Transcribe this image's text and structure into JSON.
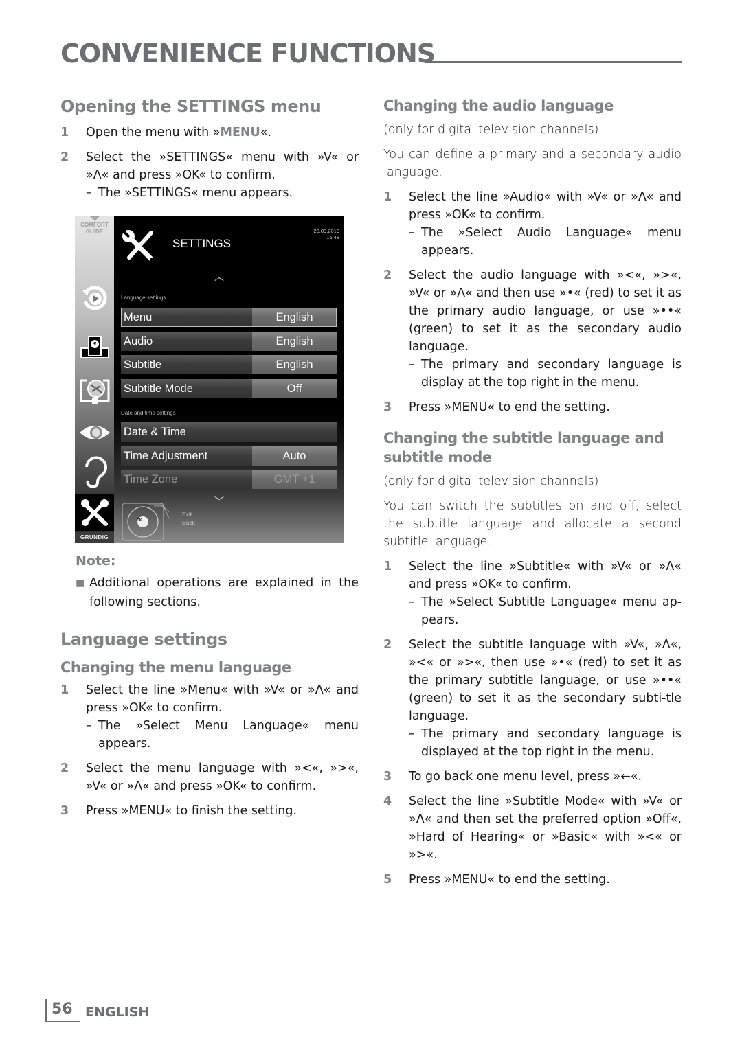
{
  "header": {
    "title": "CONVENIENCE FUNCTIONS"
  },
  "left": {
    "opening": {
      "heading": "Opening the SETTINGS menu",
      "steps": [
        {
          "num": "1",
          "parts": [
            "Open the menu with »",
            "MENU",
            "«."
          ]
        },
        {
          "num": "2",
          "text": "Select the »SETTINGS« menu with »V« or »Λ« and press »OK« to confirm.",
          "result": "The »SETTINGS« menu appears."
        }
      ]
    },
    "tv_screen": {
      "sidebar": {
        "comfort_guide": "COMFORT GUIDE",
        "brand": "GRUNDIG",
        "icons": [
          "playback-icon",
          "network-icon",
          "satellite-icon",
          "eye-icon",
          "ear-icon",
          "tools-icon"
        ]
      },
      "title": "SETTINGS",
      "date": "20.09.2010",
      "time": "15:48",
      "groups": [
        {
          "label": "Language settings",
          "rows": [
            {
              "label": "Menu",
              "value": "English",
              "selected": true
            },
            {
              "label": "Audio",
              "value": "English"
            },
            {
              "label": "Subtitle",
              "value": "English"
            },
            {
              "label": "Subtitle Mode",
              "value": "Off"
            }
          ]
        },
        {
          "label": "Date and time settings",
          "rows": [
            {
              "label": "Date & Time",
              "value": ""
            },
            {
              "label": "Time Adjustment",
              "value": "Auto"
            },
            {
              "label": "Time Zone",
              "value": "GMT +1",
              "disabled": true
            }
          ]
        }
      ],
      "remote": {
        "ok": "OK",
        "exit": "Exit",
        "back": "Back"
      }
    },
    "note": {
      "title": "Note:",
      "text": "Additional operations are explained in the following sections."
    },
    "language_settings": {
      "heading": "Language settings",
      "menu_language": {
        "heading": "Changing the menu language",
        "steps": [
          {
            "num": "1",
            "text": "Select the line »Menu« with »V« or »Λ« and press »OK« to confirm.",
            "result": "The »Select Menu Language« menu appears."
          },
          {
            "num": "2",
            "text": "Select the menu language with »<«, »>«, »V« or »Λ« and press »OK« to confirm."
          },
          {
            "num": "3",
            "text": "Press »MENU« to finish the setting."
          }
        ]
      }
    }
  },
  "right": {
    "audio": {
      "heading": "Changing the audio language",
      "note": "(only for digital television channels)",
      "intro": "You can define a primary and a secondary audio language.",
      "steps": [
        {
          "num": "1",
          "text": "Select the line »Audio« with »V« or »Λ« and press »OK« to confirm.",
          "result": "The »Select Audio Language« menu appears."
        },
        {
          "num": "2",
          "text": "Select the audio language with »<«, »>«, »V« or »Λ« and then use »•« (red) to set it as the primary audio language, or use »••« (green) to set it as the secondary audio language.",
          "result": "The primary and secondary language is display at the top right in the menu."
        },
        {
          "num": "3",
          "text": "Press »MENU« to end the setting."
        }
      ]
    },
    "subtitle": {
      "heading": "Changing the subtitle language and subtitle mode",
      "note": "(only for digital television channels)",
      "intro": "You can switch the subtitles on and off, select the subtitle language and allocate a second subtitle language.",
      "steps": [
        {
          "num": "1",
          "text": "Select the line »Subtitle« with »V« or »Λ« and press »OK« to confirm.",
          "result": "The »Select Subtitle Language« menu ap-pears."
        },
        {
          "num": "2",
          "text": "Select the subtitle language with »V«, »Λ«, »<« or »>«, then use »•« (red) to set it as the primary subtitle language, or use »••« (green) to set it as the secondary subti-tle language.",
          "result": "The primary and secondary language is displayed at the top right in the menu."
        },
        {
          "num": "3",
          "text": "To go back one menu level, press »←«."
        },
        {
          "num": "4",
          "text": "Select the line »Subtitle Mode« with »V« or »Λ« and then set the preferred option »Off«, »Hard of Hearing« or »Basic« with »<« or »>«."
        },
        {
          "num": "5",
          "text": "Press »MENU« to end the setting."
        }
      ]
    }
  },
  "footer": {
    "page_number": "56",
    "language": "ENGLISH"
  },
  "colors": {
    "heading_gray": "#808285",
    "title_gray": "#6d6e71",
    "tv_bg": "#000000"
  }
}
